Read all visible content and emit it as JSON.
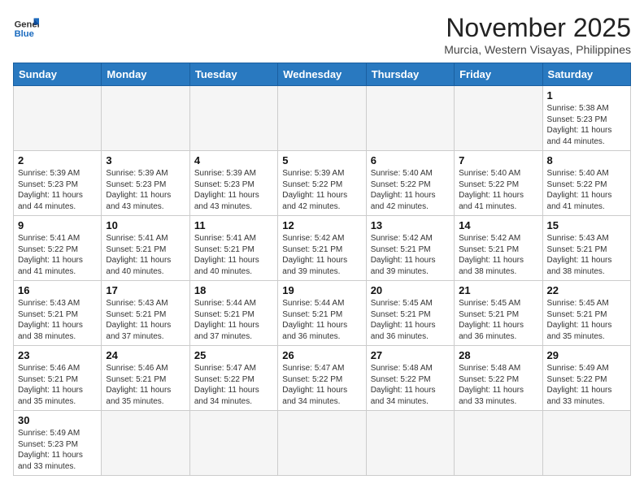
{
  "logo": {
    "general": "General",
    "blue": "Blue"
  },
  "header": {
    "month": "November 2025",
    "location": "Murcia, Western Visayas, Philippines"
  },
  "weekdays": [
    "Sunday",
    "Monday",
    "Tuesday",
    "Wednesday",
    "Thursday",
    "Friday",
    "Saturday"
  ],
  "weeks": [
    [
      {
        "day": null
      },
      {
        "day": null
      },
      {
        "day": null
      },
      {
        "day": null
      },
      {
        "day": null
      },
      {
        "day": null
      },
      {
        "day": "1",
        "sunrise": "5:38 AM",
        "sunset": "5:23 PM",
        "daylight": "11 hours and 44 minutes."
      }
    ],
    [
      {
        "day": "2",
        "sunrise": "5:39 AM",
        "sunset": "5:23 PM",
        "daylight": "11 hours and 44 minutes."
      },
      {
        "day": "3",
        "sunrise": "5:39 AM",
        "sunset": "5:23 PM",
        "daylight": "11 hours and 43 minutes."
      },
      {
        "day": "4",
        "sunrise": "5:39 AM",
        "sunset": "5:23 PM",
        "daylight": "11 hours and 43 minutes."
      },
      {
        "day": "5",
        "sunrise": "5:39 AM",
        "sunset": "5:22 PM",
        "daylight": "11 hours and 42 minutes."
      },
      {
        "day": "6",
        "sunrise": "5:40 AM",
        "sunset": "5:22 PM",
        "daylight": "11 hours and 42 minutes."
      },
      {
        "day": "7",
        "sunrise": "5:40 AM",
        "sunset": "5:22 PM",
        "daylight": "11 hours and 41 minutes."
      },
      {
        "day": "8",
        "sunrise": "5:40 AM",
        "sunset": "5:22 PM",
        "daylight": "11 hours and 41 minutes."
      }
    ],
    [
      {
        "day": "9",
        "sunrise": "5:41 AM",
        "sunset": "5:22 PM",
        "daylight": "11 hours and 41 minutes."
      },
      {
        "day": "10",
        "sunrise": "5:41 AM",
        "sunset": "5:21 PM",
        "daylight": "11 hours and 40 minutes."
      },
      {
        "day": "11",
        "sunrise": "5:41 AM",
        "sunset": "5:21 PM",
        "daylight": "11 hours and 40 minutes."
      },
      {
        "day": "12",
        "sunrise": "5:42 AM",
        "sunset": "5:21 PM",
        "daylight": "11 hours and 39 minutes."
      },
      {
        "day": "13",
        "sunrise": "5:42 AM",
        "sunset": "5:21 PM",
        "daylight": "11 hours and 39 minutes."
      },
      {
        "day": "14",
        "sunrise": "5:42 AM",
        "sunset": "5:21 PM",
        "daylight": "11 hours and 38 minutes."
      },
      {
        "day": "15",
        "sunrise": "5:43 AM",
        "sunset": "5:21 PM",
        "daylight": "11 hours and 38 minutes."
      }
    ],
    [
      {
        "day": "16",
        "sunrise": "5:43 AM",
        "sunset": "5:21 PM",
        "daylight": "11 hours and 38 minutes."
      },
      {
        "day": "17",
        "sunrise": "5:43 AM",
        "sunset": "5:21 PM",
        "daylight": "11 hours and 37 minutes."
      },
      {
        "day": "18",
        "sunrise": "5:44 AM",
        "sunset": "5:21 PM",
        "daylight": "11 hours and 37 minutes."
      },
      {
        "day": "19",
        "sunrise": "5:44 AM",
        "sunset": "5:21 PM",
        "daylight": "11 hours and 36 minutes."
      },
      {
        "day": "20",
        "sunrise": "5:45 AM",
        "sunset": "5:21 PM",
        "daylight": "11 hours and 36 minutes."
      },
      {
        "day": "21",
        "sunrise": "5:45 AM",
        "sunset": "5:21 PM",
        "daylight": "11 hours and 36 minutes."
      },
      {
        "day": "22",
        "sunrise": "5:45 AM",
        "sunset": "5:21 PM",
        "daylight": "11 hours and 35 minutes."
      }
    ],
    [
      {
        "day": "23",
        "sunrise": "5:46 AM",
        "sunset": "5:21 PM",
        "daylight": "11 hours and 35 minutes."
      },
      {
        "day": "24",
        "sunrise": "5:46 AM",
        "sunset": "5:21 PM",
        "daylight": "11 hours and 35 minutes."
      },
      {
        "day": "25",
        "sunrise": "5:47 AM",
        "sunset": "5:22 PM",
        "daylight": "11 hours and 34 minutes."
      },
      {
        "day": "26",
        "sunrise": "5:47 AM",
        "sunset": "5:22 PM",
        "daylight": "11 hours and 34 minutes."
      },
      {
        "day": "27",
        "sunrise": "5:48 AM",
        "sunset": "5:22 PM",
        "daylight": "11 hours and 34 minutes."
      },
      {
        "day": "28",
        "sunrise": "5:48 AM",
        "sunset": "5:22 PM",
        "daylight": "11 hours and 33 minutes."
      },
      {
        "day": "29",
        "sunrise": "5:49 AM",
        "sunset": "5:22 PM",
        "daylight": "11 hours and 33 minutes."
      }
    ],
    [
      {
        "day": "30",
        "sunrise": "5:49 AM",
        "sunset": "5:23 PM",
        "daylight": "11 hours and 33 minutes."
      },
      {
        "day": null
      },
      {
        "day": null
      },
      {
        "day": null
      },
      {
        "day": null
      },
      {
        "day": null
      },
      {
        "day": null
      }
    ]
  ]
}
